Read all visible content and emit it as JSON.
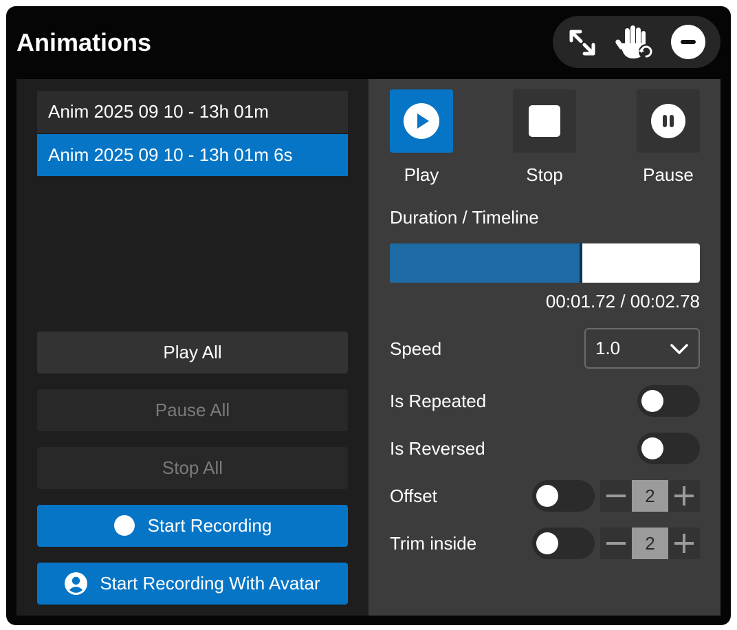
{
  "window": {
    "title": "Animations"
  },
  "toolbar": {
    "icons": [
      "expand-icon",
      "hand-refresh-icon",
      "minus-circle-icon"
    ]
  },
  "animations": [
    {
      "label": "Anim 2025 09 10 - 13h 01m",
      "selected": false
    },
    {
      "label": "Anim 2025 09 10 - 13h 01m 6s",
      "selected": true
    }
  ],
  "buttons": {
    "play_all": "Play All",
    "pause_all": "Pause All",
    "stop_all": "Stop All",
    "start_recording": "Start Recording",
    "start_recording_avatar": "Start Recording With Avatar"
  },
  "controls": {
    "play": "Play",
    "stop": "Stop",
    "pause": "Pause"
  },
  "timeline": {
    "label": "Duration / Timeline",
    "progress": 0.62,
    "time_text": "00:01.72 / 00:02.78"
  },
  "speed": {
    "label": "Speed",
    "value": "1.0"
  },
  "options": {
    "is_repeated": {
      "label": "Is Repeated",
      "on": false
    },
    "is_reversed": {
      "label": "Is Reversed",
      "on": false
    },
    "offset": {
      "label": "Offset",
      "on": false,
      "value": "2"
    },
    "trim_inside": {
      "label": "Trim inside",
      "on": false,
      "value": "2"
    }
  },
  "colors": {
    "accent": "#0675c6",
    "timeline_fill": "#1d6aa4",
    "panel_left": "#1e1e1e",
    "panel_right": "#3c3c3c"
  }
}
